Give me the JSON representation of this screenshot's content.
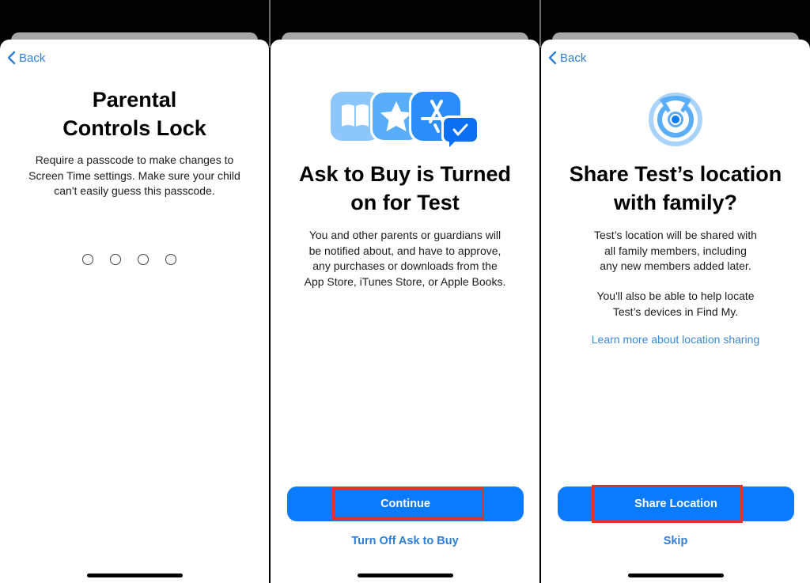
{
  "screens": [
    {
      "back_label": "Back",
      "title_line1": "Parental",
      "title_line2": "Controls Lock",
      "body": [
        "Require a passcode to make changes to",
        "Screen Time settings. Make sure your child",
        "can't easily guess this passcode."
      ],
      "passcode_digits_entered": 0,
      "passcode_length": 4
    },
    {
      "icon": "apple-books-itunes-app-store-ask-to-buy-icon",
      "title_line1": "Ask to Buy is Turned",
      "title_line2": "on for Test",
      "body": [
        "You and other parents or guardians will",
        "be notified about, and have to approve,",
        "any purchases or downloads from the",
        "App Store, iTunes Store, or Apple Books."
      ],
      "primary_button": "Continue",
      "secondary_link": "Turn Off Ask to Buy"
    },
    {
      "back_label": "Back",
      "icon": "location-sharing-icon",
      "title_line1": "Share Test’s location",
      "title_line2": "with family?",
      "body": [
        "Test’s location will be shared with",
        "all family members, including",
        "any new members added later."
      ],
      "body2": [
        "You'll also be able to help locate",
        "Test’s devices in Find My."
      ],
      "learn_more_link": "Learn more about location sharing",
      "primary_button": "Share Location",
      "secondary_link": "Skip"
    }
  ],
  "colors": {
    "accent": "#0a7aff",
    "link": "#2f7fd6",
    "highlight": "#e0312a"
  }
}
